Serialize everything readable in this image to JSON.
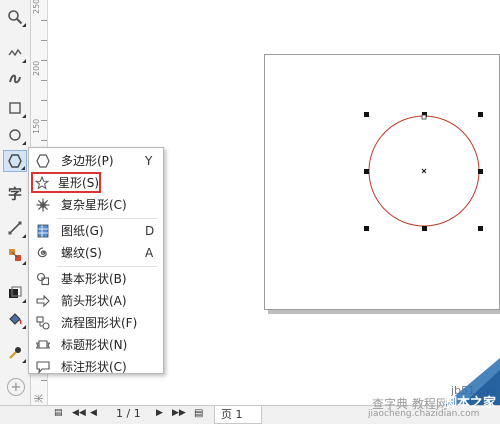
{
  "toolbox": {
    "text_tool_label": "字",
    "add_tool_label": "+"
  },
  "ruler": {
    "labels": [
      "250",
      "200",
      "150"
    ],
    "bottom_label": "米"
  },
  "flyout_menu": {
    "items": [
      {
        "label": "多边形(P)",
        "shortcut": "Y",
        "icon": "polygon-icon"
      },
      {
        "label": "星形(S)",
        "shortcut": "",
        "icon": "star-icon"
      },
      {
        "label": "复杂星形(C)",
        "shortcut": "",
        "icon": "complex-star-icon"
      },
      {
        "label": "图纸(G)",
        "shortcut": "D",
        "icon": "graph-paper-icon"
      },
      {
        "label": "螺纹(S)",
        "shortcut": "A",
        "icon": "spiral-icon"
      },
      {
        "label": "基本形状(B)",
        "shortcut": "",
        "icon": "basic-shapes-icon"
      },
      {
        "label": "箭头形状(A)",
        "shortcut": "",
        "icon": "arrow-shapes-icon"
      },
      {
        "label": "流程图形状(F)",
        "shortcut": "",
        "icon": "flowchart-shapes-icon"
      },
      {
        "label": "标题形状(N)",
        "shortcut": "",
        "icon": "banner-shapes-icon"
      },
      {
        "label": "标注形状(C)",
        "shortcut": "",
        "icon": "callout-shapes-icon"
      }
    ],
    "highlighted_item": "星形(S)"
  },
  "status_bar": {
    "page_counter": "1 / 1",
    "page_tab": "页 1"
  },
  "watermark": {
    "site_line1": "jb51.net",
    "site_line2": "查字典 教程网",
    "site_line3": "jiaocheng.chazidian.com",
    "corner_text": "脚本之家"
  },
  "colors": {
    "circle_outline": "#c0392b",
    "highlight_border": "#dd3333",
    "watermark_corner": "#2a6fb0"
  }
}
